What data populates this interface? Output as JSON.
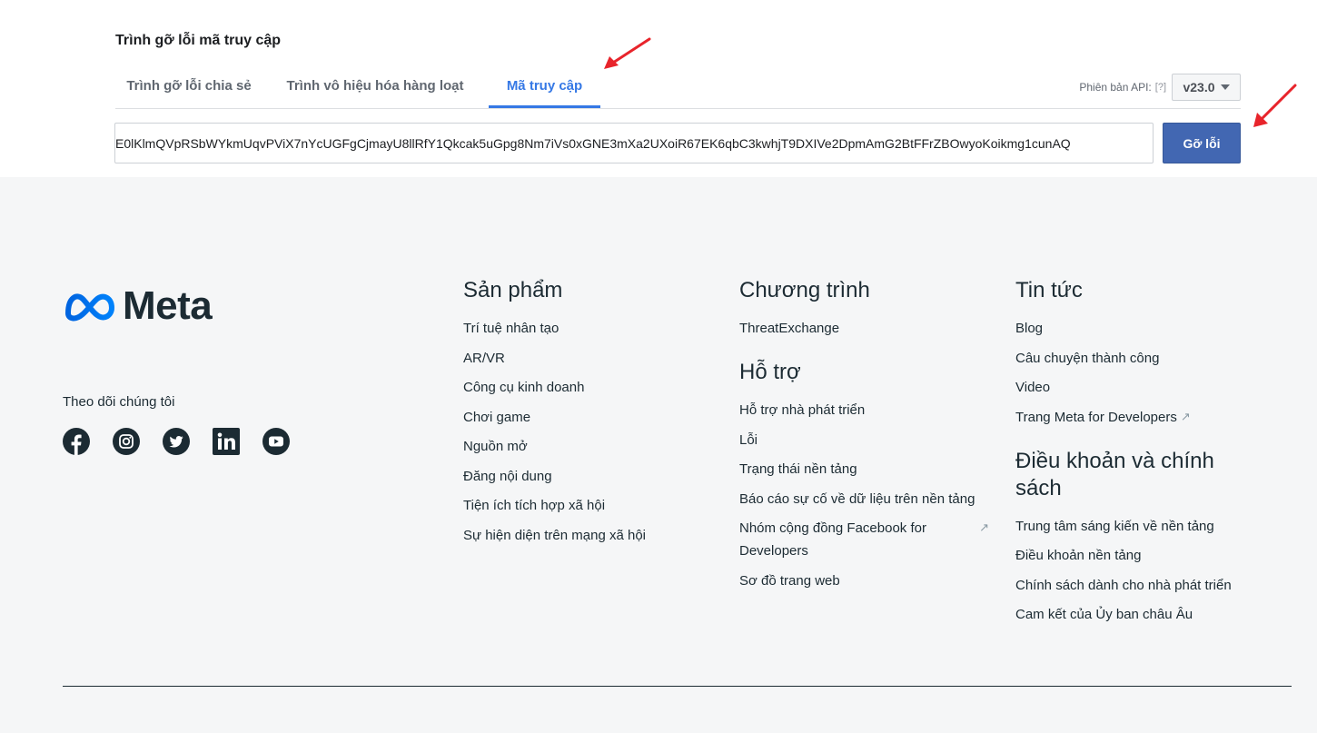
{
  "tool": {
    "title": "Trình gỡ lỗi mã truy cập",
    "tabs": [
      {
        "label": "Trình gỡ lỗi chia sẻ"
      },
      {
        "label": "Trình vô hiệu hóa hàng loạt"
      },
      {
        "label": "Mã truy cập",
        "active": true
      }
    ],
    "api_label": "Phiên bản API:",
    "api_help": "[?]",
    "api_version": "v23.0",
    "token_value": "E0lKlmQVpRSbWYkmUqvPViX7nYcUGFgCjmayU8llRfY1Qkcak5uGpg8Nm7iVs0xGNE3mXa2UXoiR67EK6qbC3kwhjT9DXIVe2DpmAmG2BtFFrZBOwyoKoikmg1cunAQ",
    "debug_button": "Gỡ lỗi",
    "accent_color": "#3578e5",
    "button_color": "#4267b2"
  },
  "footer": {
    "logo_text": "Meta",
    "follow_label": "Theo dõi chúng tôi",
    "socials": [
      "facebook-icon",
      "instagram-icon",
      "twitter-icon",
      "linkedin-icon",
      "youtube-icon"
    ],
    "products": {
      "heading": "Sản phẩm",
      "links": [
        "Trí tuệ nhân tạo",
        "AR/VR",
        "Công cụ kinh doanh",
        "Chơi game",
        "Nguồn mở",
        "Đăng nội dung",
        "Tiện ích tích hợp xã hội",
        "Sự hiện diện trên mạng xã hội"
      ]
    },
    "programs": {
      "heading": "Chương trình",
      "links": [
        "ThreatExchange"
      ]
    },
    "support": {
      "heading": "Hỗ trợ",
      "links": [
        "Hỗ trợ nhà phát triển",
        "Lỗi",
        "Trạng thái nền tảng",
        "Báo cáo sự cố về dữ liệu trên nền tảng",
        "Nhóm cộng đồng Facebook for Developers",
        "Sơ đồ trang web"
      ]
    },
    "news": {
      "heading": "Tin tức",
      "links": [
        "Blog",
        "Câu chuyện thành công",
        "Video",
        "Trang Meta for Developers"
      ]
    },
    "terms": {
      "heading": "Điều khoản và chính sách",
      "links": [
        "Trung tâm sáng kiến về nền tảng",
        "Điều khoản nền tảng",
        "Chính sách dành cho nhà phát triển",
        "Cam kết của Ủy ban châu Âu"
      ]
    }
  }
}
